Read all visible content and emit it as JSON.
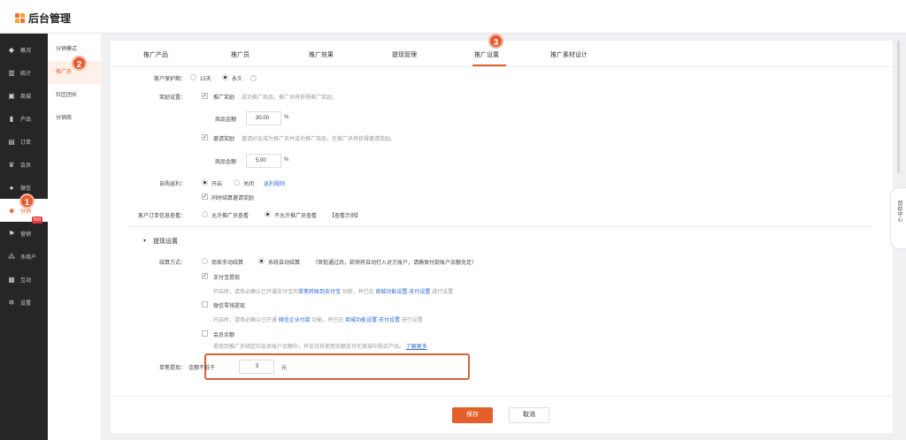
{
  "app": {
    "title": "后台管理"
  },
  "sidebar": {
    "items": [
      {
        "label": "概况",
        "icon": "dashboard-icon"
      },
      {
        "label": "统计",
        "icon": "stats-icon"
      },
      {
        "label": "商城",
        "icon": "store-icon"
      },
      {
        "label": "产品",
        "icon": "product-icon"
      },
      {
        "label": "订单",
        "icon": "order-icon"
      },
      {
        "label": "会员",
        "icon": "crown-icon"
      },
      {
        "label": "微信",
        "icon": "wechat-icon"
      },
      {
        "label": "分销",
        "icon": "user-share-icon"
      },
      {
        "label": "营销",
        "icon": "flag-icon"
      },
      {
        "label": "多商户",
        "icon": "merchant-icon"
      },
      {
        "label": "互动",
        "icon": "interact-icon"
      },
      {
        "label": "设置",
        "icon": "gear-icon"
      }
    ],
    "hot_badge": "hot"
  },
  "subnav": {
    "items": [
      "分销模式",
      "推广员",
      "社区团长",
      "分销商"
    ]
  },
  "markers": [
    "1",
    "2",
    "3"
  ],
  "tabs": [
    "推广产品",
    "推广员",
    "推广效果",
    "提现管理",
    "推广设置",
    "推广素材设计"
  ],
  "form": {
    "protect_label": "客户保护期：",
    "protect_opt1": "15天",
    "protect_opt2": "永久",
    "reward_label": "奖励设置：",
    "reward_promote": "推广奖励",
    "reward_promote_desc": "成功推广商品，推广员将获得推广奖励。",
    "amount_label": "商品金额",
    "amount1_value": "30.00",
    "percent": "%",
    "reward_invite": "邀请奖励",
    "reward_invite_desc": "邀请好友成为推广员并成功推广商品，在推广员将获得邀请奖励。",
    "amount2_value": "5.00",
    "self_buy_label": "自购返利：",
    "on": "开启",
    "off": "关闭",
    "self_buy_link": "返利规则",
    "also_invite": "同时结算邀请奖励",
    "order_info_label": "客户订单信息查看：",
    "order_opt1": "允许推广员查看",
    "order_opt2": "不允许推广员查看",
    "order_example": "【查看示例】",
    "withdraw_section": "提现设置",
    "settle_label": "结算方式：",
    "settle_opt1": "商家手动结算",
    "settle_opt2": "系统自动结算",
    "settle_desc": "（审批通过后，款项将自动打入对方账户，请确保付款账户余额充足）",
    "alipay": "支付宝提现",
    "alipay_desc1": "开启时，请务必确认已开通支付宝的",
    "alipay_link1": "单笔转账到支付宝",
    "alipay_desc2": "功能，并已在",
    "alipay_link2": "商城功能设置-支付设置",
    "alipay_desc3": "进行设置",
    "wechat": "微信零钱提现",
    "wechat_desc1": "开启时，请务必确认已开通",
    "wechat_link1": "微信企业付款",
    "wechat_desc2": "功能，并已在",
    "wechat_link2": "商城功能设置-支付设置",
    "wechat_desc3": "进行设置",
    "member_balance": "会员余额",
    "member_desc": "提现到推广员绑定的会员账户余额中，并支持其使用余额支付在商城中购买产品。",
    "member_link": "了解更多",
    "single_withdraw_label": "单笔提现：",
    "min_label": "金额不低于",
    "min_value": "5",
    "unit": "元"
  },
  "footer": {
    "save": "保存",
    "cancel": "取消"
  },
  "help_center": "帮助中心",
  "colors": {
    "accent": "#e55f2c",
    "sidebar_bg": "#262626",
    "link": "#2e6ad6"
  }
}
